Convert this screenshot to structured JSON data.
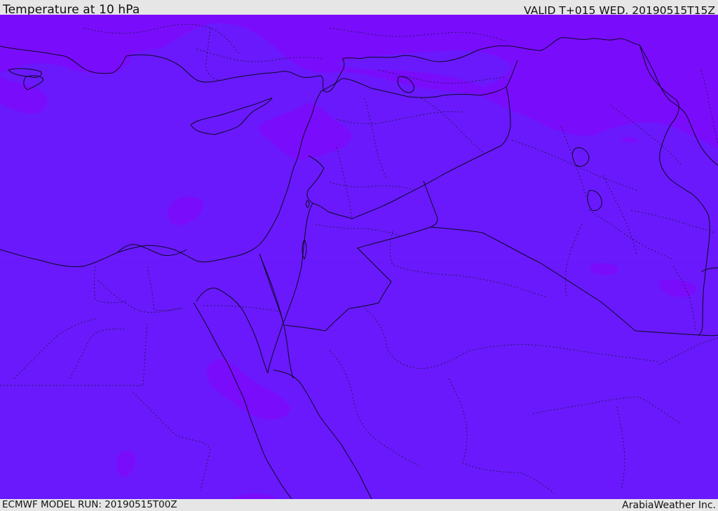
{
  "header": {
    "title": "Temperature at 10 hPa",
    "valid": "VALID T+015 WED. 20190515T15Z"
  },
  "footer": {
    "model_run": "ECMWF MODEL RUN: 20190515T00Z",
    "credit": "ArabiaWeather Inc."
  },
  "colors": {
    "field_base": "#6a19fc",
    "field_warm_band": "#7a0cfc",
    "band_bg": "#e6e6e6"
  }
}
